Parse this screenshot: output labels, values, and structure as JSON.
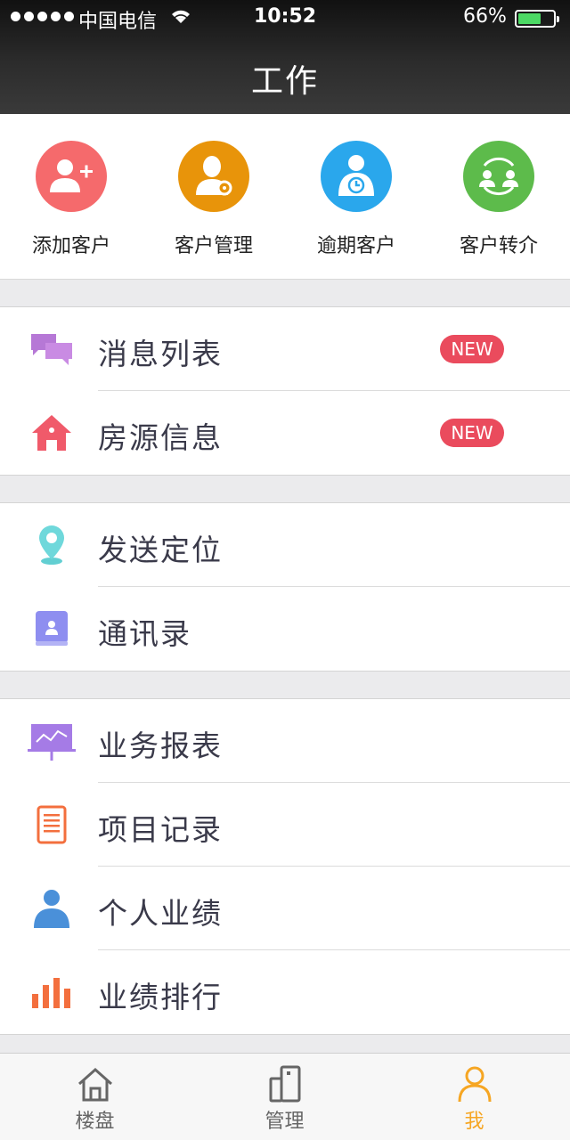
{
  "status_bar": {
    "carrier": "中国电信",
    "time": "10:52",
    "battery": "66%",
    "battery_level": 0.66
  },
  "nav": {
    "title": "工作"
  },
  "quick_actions": [
    {
      "label": "添加客户",
      "icon": "add-user-icon",
      "color": "#f56a6c"
    },
    {
      "label": "客户管理",
      "icon": "user-settings-icon",
      "color": "#e8940a"
    },
    {
      "label": "逾期客户",
      "icon": "user-clock-icon",
      "color": "#2aa7ec"
    },
    {
      "label": "客户转介",
      "icon": "user-transfer-icon",
      "color": "#5dbb4b"
    }
  ],
  "groups": [
    [
      {
        "label": "消息列表",
        "icon": "chat-bubbles-icon",
        "badge": "NEW"
      },
      {
        "label": "房源信息",
        "icon": "house-icon",
        "badge": "NEW"
      }
    ],
    [
      {
        "label": "发送定位",
        "icon": "location-pin-icon"
      },
      {
        "label": "通讯录",
        "icon": "contacts-book-icon"
      }
    ],
    [
      {
        "label": "业务报表",
        "icon": "report-board-icon"
      },
      {
        "label": "项目记录",
        "icon": "document-list-icon"
      },
      {
        "label": "个人业绩",
        "icon": "person-icon"
      },
      {
        "label": "业绩排行",
        "icon": "bar-ranking-icon"
      }
    ]
  ],
  "tabbar": {
    "active": 2,
    "tabs": [
      {
        "label": "楼盘",
        "icon": "building-house-icon"
      },
      {
        "label": "管理",
        "icon": "management-icon"
      },
      {
        "label": "我",
        "icon": "user-profile-icon"
      }
    ]
  },
  "colors": {
    "badge": "#ea4b5d",
    "tab_active": "#f6a623",
    "battery": "#4cd964"
  }
}
